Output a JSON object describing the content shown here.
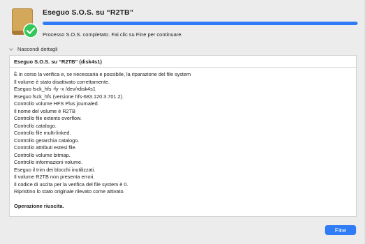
{
  "window": {
    "title": "Eseguo S.O.S. su “R2TB”",
    "progress_fraction": 1.0,
    "status": "Processo S.O.S. completato. Fai clic su Fine per continuare.",
    "details_toggle": "Nascondi dettagli"
  },
  "log": {
    "title": "Eseguo S.O.S. su “R2TB” (disk4s1)",
    "lines": [
      "È in corso la verifica e, se necessaria e possibile, la riparazione del file system",
      "Il volume è stato disattivato correttamente.",
      "Eseguo fsck_hfs -fy -x /dev/rdisk4s1",
      "Eseguo fsck_hfs (versione hfs-683.120.3.701.2).",
      "Controllo volume HFS Plus journaled.",
      "Il nome del volume è R2TB",
      "Controllo file extents overflow.",
      "Controllo catalogo.",
      "Controllo file multi-linked.",
      "Controllo gerarchia catalogo.",
      "Controllo attributi estesi file.",
      "Controllo volume bitmap.",
      "Controllo informazioni volume.",
      "Eseguo il trim dei blocchi inutilizzati.",
      "Il volume R2TB non presenta errori.",
      "Il codice di uscita per la verifica del file system è 0.",
      "Ripristino lo stato originale rilevato come attivato."
    ],
    "result": "Operazione riuscita."
  },
  "buttons": {
    "done_label": "Fine"
  },
  "colors": {
    "accent": "#2f7cf6",
    "drive": "#c79a4f",
    "check": "#34c759"
  },
  "icons": {
    "drive": "external-drive-icon",
    "check": "checkmark-badge-icon",
    "chevron": "chevron-down-icon"
  }
}
